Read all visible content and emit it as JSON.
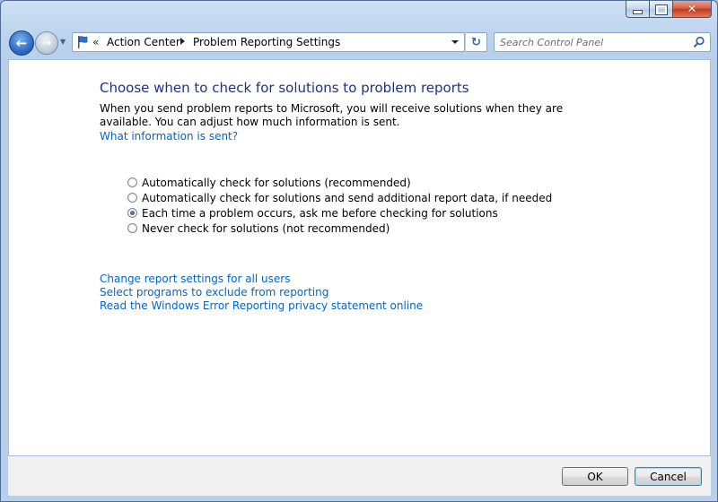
{
  "window": {
    "caption_buttons": {
      "minimize": "minimize",
      "maximize": "maximize",
      "close": "✕"
    }
  },
  "nav": {
    "back_glyph": "←",
    "forward_glyph": "→"
  },
  "address": {
    "chevron": "«",
    "crumbs": [
      "Action Center",
      "Problem Reporting Settings"
    ],
    "refresh_glyph": "↻"
  },
  "search": {
    "placeholder": "Search Control Panel"
  },
  "content": {
    "title": "Choose when to check for solutions to problem reports",
    "description": "When you send problem reports to Microsoft, you will receive solutions when they are available. You can adjust how much information is sent.",
    "info_link": "What information is sent?",
    "options": [
      {
        "label": "Automatically check for solutions (recommended)",
        "checked": false
      },
      {
        "label": "Automatically check for solutions and send additional report data, if needed",
        "checked": false
      },
      {
        "label": "Each time a problem occurs, ask me before checking for solutions",
        "checked": true
      },
      {
        "label": "Never check for solutions (not recommended)",
        "checked": false
      }
    ],
    "links": [
      "Change report settings for all users",
      "Select programs to exclude from reporting",
      "Read the Windows Error Reporting privacy statement online"
    ]
  },
  "footer": {
    "ok_label": "OK",
    "cancel_label": "Cancel"
  },
  "colors": {
    "title": "#1e3287",
    "link": "#0066cc",
    "close_button": "#c23a1d"
  }
}
